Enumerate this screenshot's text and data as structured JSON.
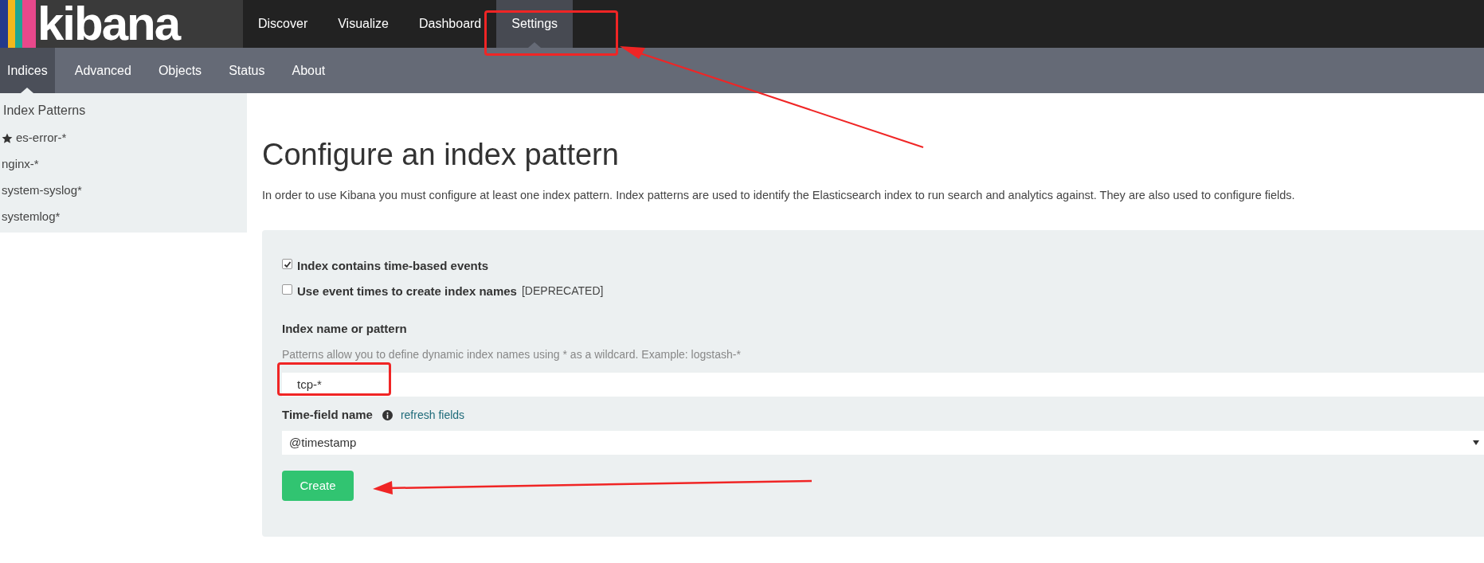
{
  "logo": {
    "text": "kibana"
  },
  "top_nav": [
    {
      "label": "Discover",
      "selected": false
    },
    {
      "label": "Visualize",
      "selected": false
    },
    {
      "label": "Dashboard",
      "selected": false
    },
    {
      "label": "Settings",
      "selected": true
    }
  ],
  "sub_nav": [
    {
      "label": "Indices",
      "selected": true
    },
    {
      "label": "Advanced",
      "selected": false
    },
    {
      "label": "Objects",
      "selected": false
    },
    {
      "label": "Status",
      "selected": false
    },
    {
      "label": "About",
      "selected": false
    }
  ],
  "sidebar": {
    "title": "Index Patterns",
    "items": [
      {
        "label": "es-error-*",
        "default": true
      },
      {
        "label": "nginx-*",
        "default": false
      },
      {
        "label": "system-syslog*",
        "default": false
      },
      {
        "label": "systemlog*",
        "default": false
      }
    ]
  },
  "main": {
    "title": "Configure an index pattern",
    "description": "In order to use Kibana you must configure at least one index pattern. Index patterns are used to identify the Elasticsearch index to run search and analytics against. They are also used to configure fields.",
    "checkboxes": [
      {
        "label": "Index contains time-based events",
        "checked": true
      },
      {
        "label": "Use event times to create index names",
        "note": "[DEPRECATED]",
        "checked": false
      }
    ],
    "pattern_label": "Index name or pattern",
    "pattern_help": "Patterns allow you to define dynamic index names using * as a wildcard. Example: logstash-*",
    "pattern_value": "tcp-*",
    "time_field_label": "Time-field name",
    "refresh_link": "refresh fields",
    "time_field_value": "@timestamp",
    "create_button": "Create"
  }
}
